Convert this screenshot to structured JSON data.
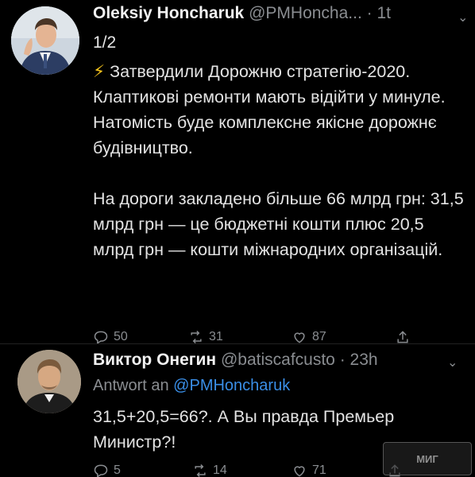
{
  "tweets": [
    {
      "author": {
        "name": "Oleksiy Honcharuk",
        "handle": "@PMHoncha...",
        "time": "1t"
      },
      "thread_label": "1/2",
      "paragraphs": [
        "Затвердили Дорожню стратегію-2020. Клаптикові ремонти мають відійти у минуле. Натомість буде комплексне якісне дорожнє будівництво.",
        "На дороги закладено більше 66 млрд грн: 31,5 млрд грн — це бюджетні кошти плюс 20,5 млрд грн — кошти міжнародних організацій."
      ],
      "actions": {
        "replies": "50",
        "retweets": "31",
        "likes": "87"
      }
    },
    {
      "author": {
        "name": "Виктор Онегин",
        "handle": "@batiscafcusto",
        "time": "23h"
      },
      "reply_prefix": "Antwort an",
      "reply_to": "@PMHoncharuk",
      "paragraphs": [
        "31,5+20,5=66?. А Вы правда Премьер Министр?!"
      ],
      "actions": {
        "replies": "5",
        "retweets": "14",
        "likes": "71"
      }
    }
  ],
  "watermark": "МИГ",
  "colors": {
    "background": "#000000",
    "text": "#e3e3e3",
    "muted": "#8a8d91",
    "link": "#3a8ee6",
    "bolt": "#f4c21c"
  },
  "icons": [
    "lightning-icon",
    "reply-icon",
    "retweet-icon",
    "like-icon",
    "share-icon",
    "chevron-down-icon"
  ]
}
